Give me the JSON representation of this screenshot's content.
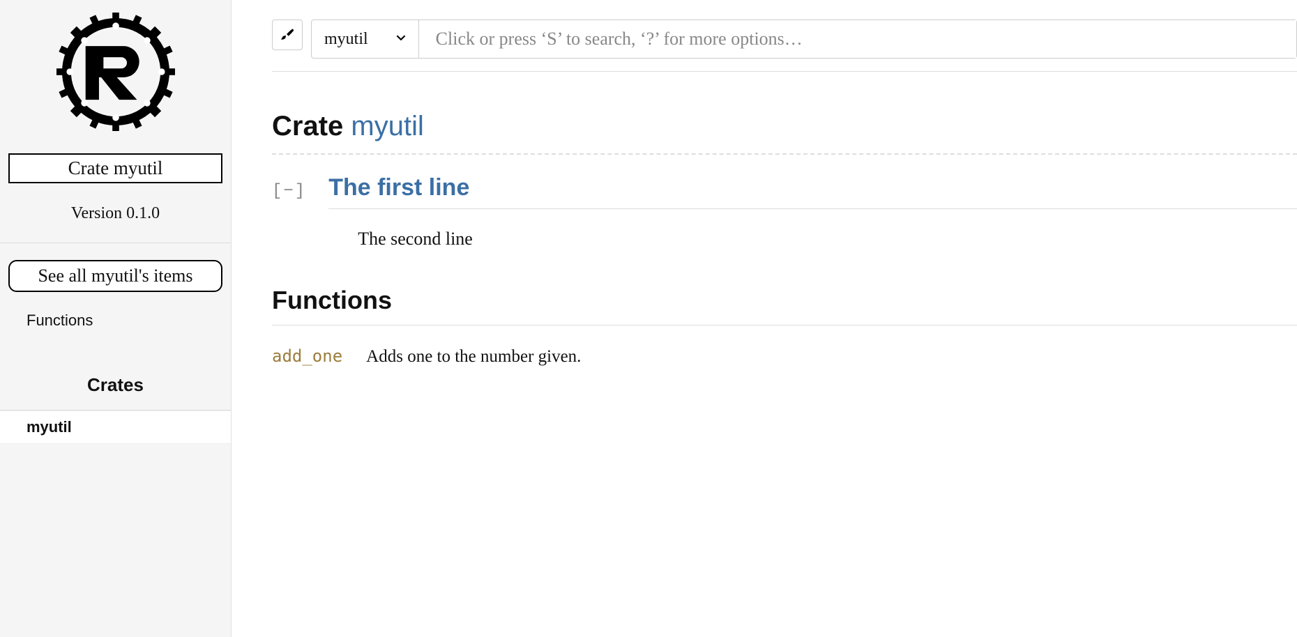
{
  "sidebar": {
    "crate_title": "Crate myutil",
    "version": "Version 0.1.0",
    "see_all": "See all myutil's items",
    "sections": [
      "Functions"
    ],
    "crates_heading": "Crates",
    "crates": [
      "myutil"
    ]
  },
  "topbar": {
    "select_value": "myutil",
    "search_placeholder": "Click or press ‘S’ to search, ‘?’ for more options…"
  },
  "main": {
    "heading_prefix": "Crate ",
    "crate_name": "myutil",
    "collapse_glyph": "[−]",
    "first_line": "The first line",
    "second_line": "The second line",
    "functions_heading": "Functions",
    "functions": [
      {
        "name": "add_one",
        "desc": "Adds one to the number given."
      }
    ]
  }
}
